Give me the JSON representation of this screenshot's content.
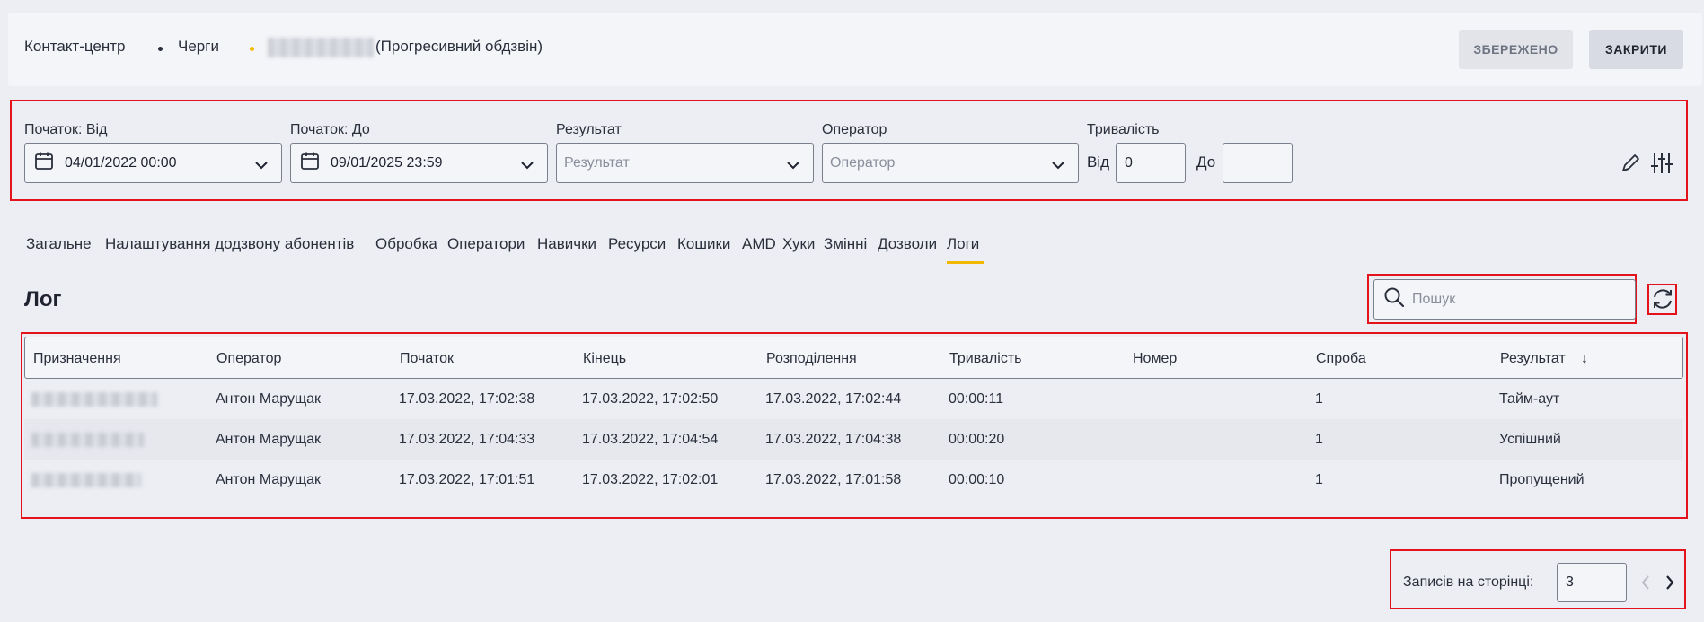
{
  "breadcrumb": {
    "items": [
      "Контакт-центр",
      "Черги"
    ],
    "current_suffix": "(Прогресивний обдзвін)"
  },
  "header": {
    "saved_label": "ЗБЕРЕЖЕНО",
    "close_label": "ЗАКРИТИ"
  },
  "filters": {
    "start_from": {
      "label": "Початок: Від",
      "value": "04/01/2022 00:00"
    },
    "start_to": {
      "label": "Початок: До",
      "value": "09/01/2025 23:59"
    },
    "result": {
      "label": "Результат",
      "placeholder": "Результат"
    },
    "operator": {
      "label": "Оператор",
      "placeholder": "Оператор"
    },
    "duration": {
      "label": "Тривалість",
      "from_label": "Від",
      "from_value": "0",
      "to_label": "До",
      "to_value": ""
    }
  },
  "tabs": [
    "Загальне",
    "Налаштування додзвону абонентів",
    "Обробка",
    "Оператори",
    "Навички",
    "Ресурси",
    "Кошики",
    "AMD",
    "Хуки",
    "Змінні",
    "Дозволи",
    "Логи"
  ],
  "active_tab": "Логи",
  "log": {
    "title": "Лог",
    "search_placeholder": "Пошук",
    "columns": [
      "Призначення",
      "Оператор",
      "Початок",
      "Кінець",
      "Розподілення",
      "Тривалість",
      "Номер",
      "Спроба",
      "Результат"
    ],
    "sort_indicator": "↓",
    "rows": [
      {
        "destination": "",
        "operator": "Антон Марущак",
        "start": "17.03.2022, 17:02:38",
        "end": "17.03.2022, 17:02:50",
        "distribution": "17.03.2022, 17:02:44",
        "duration": "00:00:11",
        "number": "",
        "attempt": "1",
        "result": "Тайм-аут"
      },
      {
        "destination": "",
        "operator": "Антон Марущак",
        "start": "17.03.2022, 17:04:33",
        "end": "17.03.2022, 17:04:54",
        "distribution": "17.03.2022, 17:04:38",
        "duration": "00:00:20",
        "number": "",
        "attempt": "1",
        "result": "Успішний"
      },
      {
        "destination": "",
        "operator": "Антон Марущак",
        "start": "17.03.2022, 17:01:51",
        "end": "17.03.2022, 17:02:01",
        "distribution": "17.03.2022, 17:01:58",
        "duration": "00:00:10",
        "number": "",
        "attempt": "1",
        "result": "Пропущений"
      }
    ]
  },
  "pagination": {
    "label": "Записів на сторінці:",
    "value": "3"
  },
  "colors": {
    "accent": "#f2b800",
    "highlight": "#e3121b"
  }
}
